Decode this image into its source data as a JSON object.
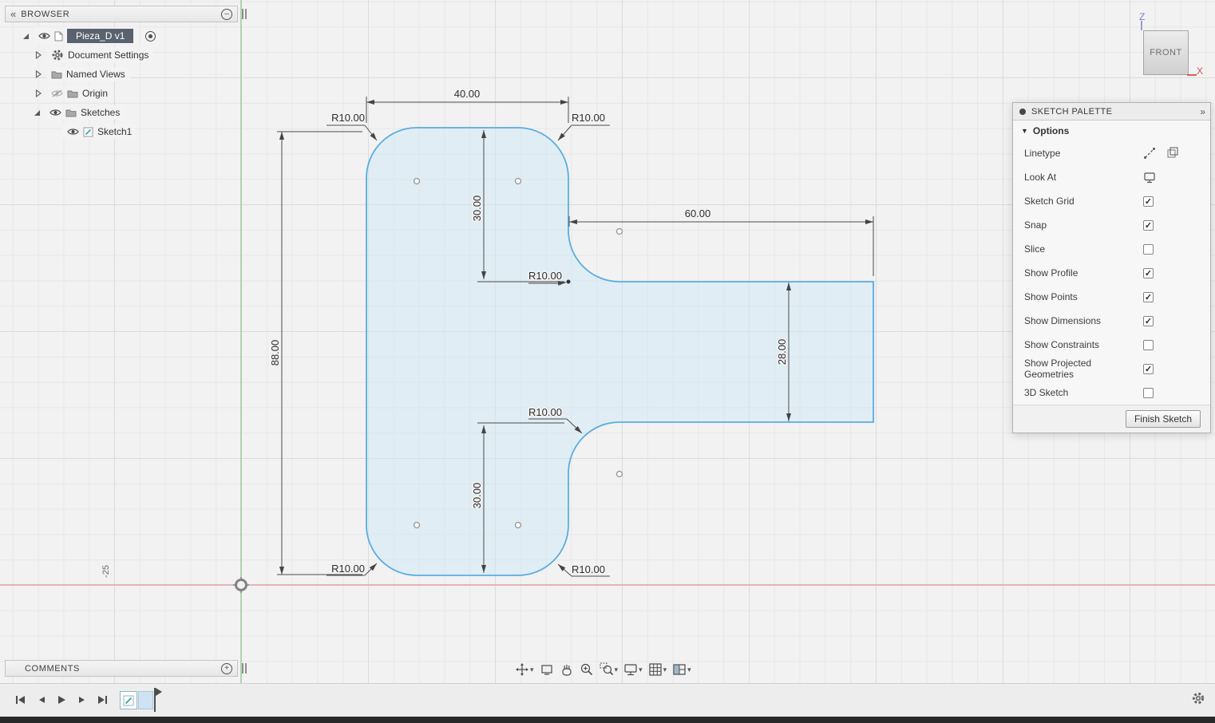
{
  "browser_panel": {
    "title": "BROWSER",
    "rows": [
      {
        "label": "Pieza_D v1"
      },
      {
        "label": "Document Settings"
      },
      {
        "label": "Named Views"
      },
      {
        "label": "Origin"
      },
      {
        "label": "Sketches"
      },
      {
        "label": "Sketch1"
      }
    ]
  },
  "view_cube": {
    "face_label": "FRONT",
    "z_label": "Z",
    "x_label": "X"
  },
  "sketch_palette": {
    "title": "SKETCH PALETTE",
    "section_label": "Options",
    "rows": [
      {
        "label": "Linetype",
        "control": "icons"
      },
      {
        "label": "Look At",
        "control": "icon"
      },
      {
        "label": "Sketch Grid",
        "control": "checkbox",
        "checked": true
      },
      {
        "label": "Snap",
        "control": "checkbox",
        "checked": true
      },
      {
        "label": "Slice",
        "control": "checkbox",
        "checked": false
      },
      {
        "label": "Show Profile",
        "control": "checkbox",
        "checked": true
      },
      {
        "label": "Show Points",
        "control": "checkbox",
        "checked": true
      },
      {
        "label": "Show Dimensions",
        "control": "checkbox",
        "checked": true
      },
      {
        "label": "Show Constraints",
        "control": "checkbox",
        "checked": false
      },
      {
        "label": "Show Projected Geometries",
        "control": "checkbox",
        "checked": true
      },
      {
        "label": "3D Sketch",
        "control": "checkbox",
        "checked": false
      }
    ],
    "finish_button_label": "Finish Sketch"
  },
  "comments_panel": {
    "title": "COMMENTS"
  },
  "sketch": {
    "dim_top_width": "40.00",
    "dim_left_height": "88.00",
    "dim_upper_offset": "30.00",
    "dim_arm_length": "60.00",
    "dim_arm_width": "28.00",
    "dim_lower_offset": "30.00",
    "fillet_radius_label": "R10.00",
    "grid_coord_label": "-25",
    "profile_fill": "rgba(205,231,246,0.5)",
    "profile_stroke": "#58ade0"
  },
  "icons": {
    "collapse_left": "«",
    "expand_right": "»",
    "caret_down": "▾",
    "section_caret": "▼",
    "check": "✓",
    "minus": "–",
    "plus": "+"
  }
}
